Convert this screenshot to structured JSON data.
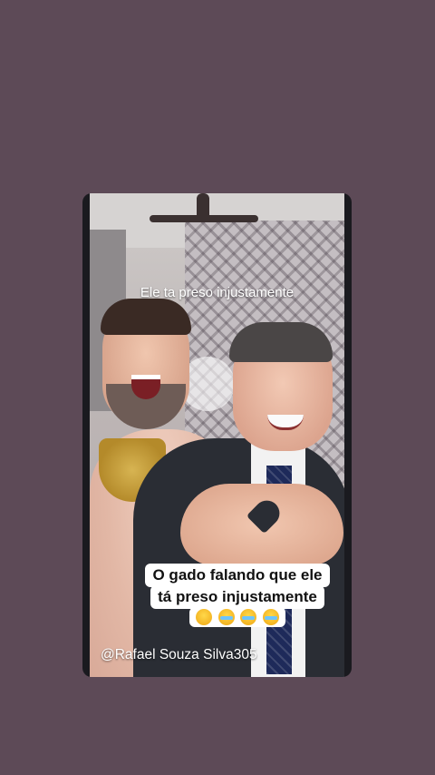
{
  "story": {
    "top_caption": "Ele ta preso injustamente",
    "main_caption_line1": "O gado falando que ele",
    "main_caption_line2": "tá preso injustamente",
    "emoji_line": [
      "rolling-eyes-emoji",
      "rofl-emoji",
      "rofl-emoji",
      "rofl-emoji"
    ],
    "watermark": "@Rafael Souza Silva305"
  },
  "colors": {
    "background": "#5d4a57",
    "caption_box": "#ffffff",
    "caption_text": "#111111"
  }
}
